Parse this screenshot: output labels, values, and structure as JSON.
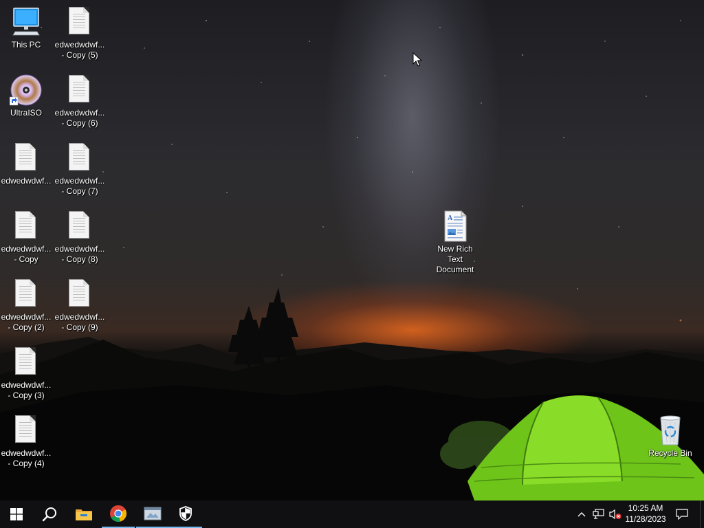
{
  "desktop": {
    "wallpaper": "night-sky-camping-tent",
    "icons": [
      {
        "name": "this-pc",
        "label": "This PC",
        "icon": "computer-icon"
      },
      {
        "name": "ultraiso",
        "label": "UltraISO",
        "icon": "disc-icon"
      },
      {
        "name": "edwedwdwf",
        "label": "edwedwdwf...",
        "icon": "text-file-icon"
      },
      {
        "name": "edwedwdwf-copy",
        "label": "edwedwdwf...\n- Copy",
        "icon": "text-file-icon"
      },
      {
        "name": "edwedwdwf-copy-2",
        "label": "edwedwdwf...\n- Copy (2)",
        "icon": "text-file-icon"
      },
      {
        "name": "edwedwdwf-copy-3",
        "label": "edwedwdwf...\n- Copy (3)",
        "icon": "text-file-icon"
      },
      {
        "name": "edwedwdwf-copy-4",
        "label": "edwedwdwf...\n- Copy (4)",
        "icon": "text-file-icon"
      },
      {
        "name": "edwedwdwf-copy-5",
        "label": "edwedwdwf...\n- Copy (5)",
        "icon": "text-file-icon"
      },
      {
        "name": "edwedwdwf-copy-6",
        "label": "edwedwdwf...\n- Copy (6)",
        "icon": "text-file-icon"
      },
      {
        "name": "edwedwdwf-copy-7",
        "label": "edwedwdwf...\n- Copy (7)",
        "icon": "text-file-icon"
      },
      {
        "name": "edwedwdwf-copy-8",
        "label": "edwedwdwf...\n- Copy (8)",
        "icon": "text-file-icon"
      },
      {
        "name": "edwedwdwf-copy-9",
        "label": "edwedwdwf...\n- Copy (9)",
        "icon": "text-file-icon"
      },
      {
        "name": "new-rich-text-document",
        "label": "New Rich Text\nDocument",
        "icon": "rich-text-document-icon"
      },
      {
        "name": "recycle-bin",
        "label": "Recycle Bin",
        "icon": "recycle-bin-icon"
      }
    ]
  },
  "taskbar": {
    "start": {
      "icon": "windows-start-icon"
    },
    "search": {
      "icon": "search-icon"
    },
    "pinned": [
      {
        "name": "file-explorer",
        "icon": "folder-icon",
        "active": false
      },
      {
        "name": "chrome",
        "icon": "chrome-icon",
        "active": true
      },
      {
        "name": "app-window",
        "icon": "app-window-icon",
        "active": true
      },
      {
        "name": "windows-security",
        "icon": "shield-icon",
        "active": true
      }
    ],
    "tray": {
      "chevron": "chevron-up-icon",
      "network": "network-icon",
      "volume": "volume-muted-icon",
      "notifications": "notification-icon"
    },
    "clock": {
      "time": "10:25 AM",
      "date": "11/28/2023"
    }
  },
  "colors": {
    "taskbar": "#101012",
    "active_indicator": "#76b9ed",
    "tent": "#7bd41a"
  }
}
